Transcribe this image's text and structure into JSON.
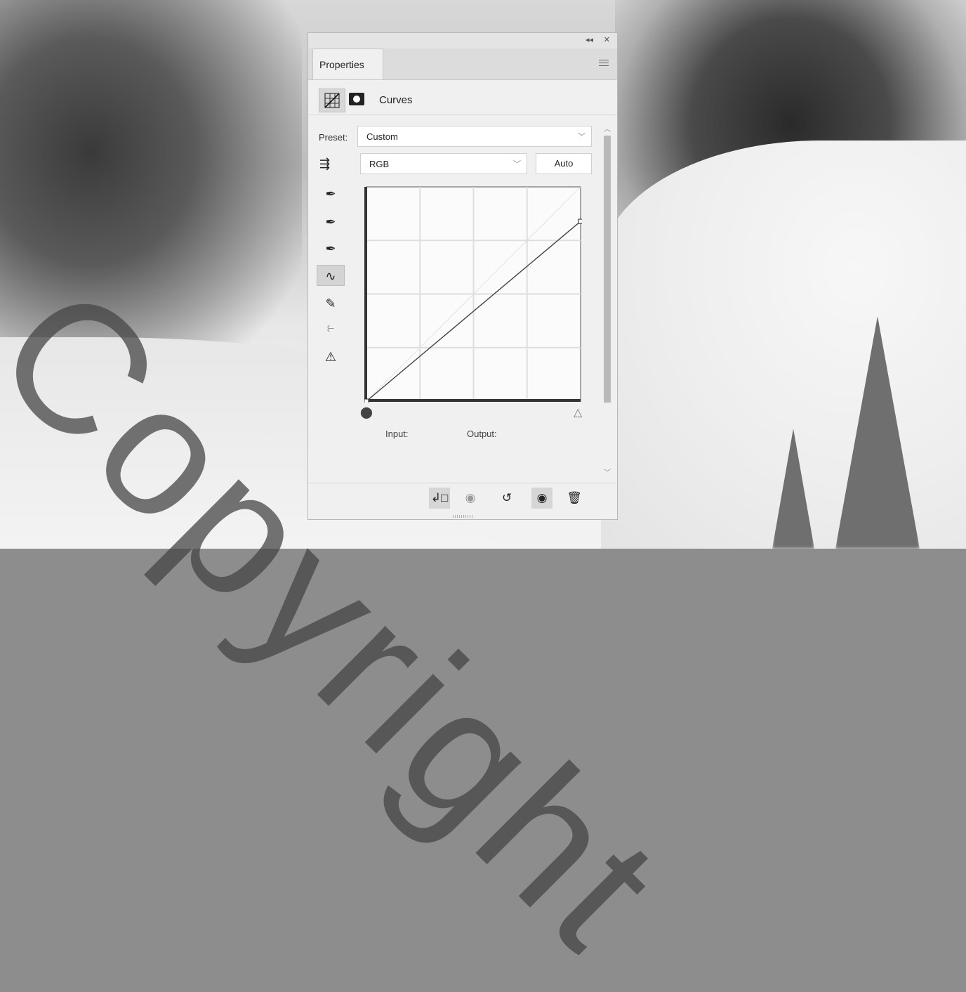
{
  "panel": {
    "tab_label": "Properties",
    "adjustment_title": "Curves",
    "preset_label": "Preset:",
    "preset_value": "Custom",
    "channel_value": "RGB",
    "auto_label": "Auto",
    "input_label": "Input:",
    "output_label": "Output:",
    "titlebar_collapse": "◂◂",
    "titlebar_close": "✕"
  },
  "tools": [
    {
      "name": "black-point-eyedropper-icon",
      "glyph": "✒"
    },
    {
      "name": "gray-point-eyedropper-icon",
      "glyph": "✒"
    },
    {
      "name": "white-point-eyedropper-icon",
      "glyph": "✒"
    },
    {
      "name": "curve-edit-points-icon",
      "glyph": "∿",
      "active": true
    },
    {
      "name": "pencil-draw-icon",
      "glyph": "✎"
    },
    {
      "name": "smooth-curve-icon",
      "glyph": "⥼",
      "dim": true
    },
    {
      "name": "clipping-warning-icon",
      "glyph": "⚠"
    }
  ],
  "footer": {
    "clip_to_layer": "↲□",
    "view_previous": "◉",
    "reset": "↺",
    "toggle_visibility": "◉",
    "delete": "🗑"
  },
  "curve": {
    "points": [
      [
        0,
        0
      ],
      [
        255,
        214
      ]
    ],
    "grid_divisions": 4
  },
  "watermark_text": "Copyright",
  "colors": {
    "panel_bg": "#f0f0f0",
    "curve_line": "#444444"
  }
}
